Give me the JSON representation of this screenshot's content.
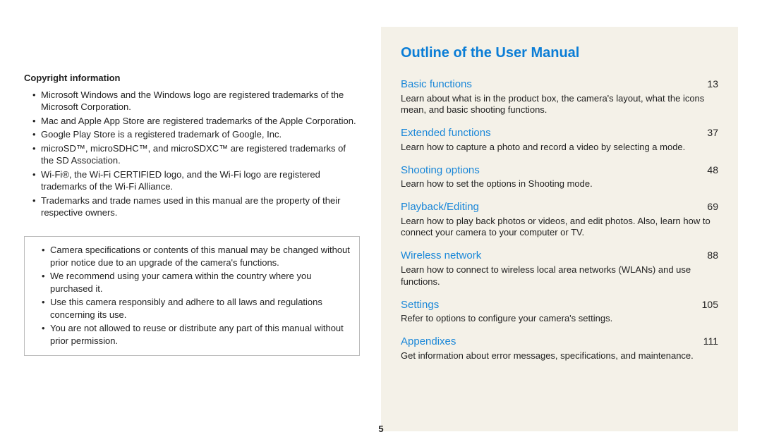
{
  "left": {
    "heading": "Copyright information",
    "bullets": [
      "Microsoft Windows and the Windows logo are registered trademarks of the Microsoft Corporation.",
      "Mac and Apple App Store are registered trademarks of the Apple Corporation.",
      "Google Play Store is a registered trademark of Google, Inc.",
      "microSD™, microSDHC™, and microSDXC™ are registered trademarks of the SD Association.",
      "Wi-Fi®, the Wi-Fi CERTIFIED logo, and the Wi-Fi logo are registered trademarks of the Wi-Fi Alliance.",
      "Trademarks and trade names used in this manual are the property of their respective owners."
    ],
    "notice": [
      "Camera specifications or contents of this manual may be changed without prior notice due to an upgrade of the camera's functions.",
      "We recommend using your camera within the country where you purchased it.",
      "Use this camera responsibly and adhere to all laws and regulations concerning its use.",
      "You are not allowed to reuse or distribute any part of this manual without prior permission."
    ]
  },
  "right": {
    "title": "Outline of the User Manual",
    "items": [
      {
        "name": "Basic functions",
        "page": "13",
        "desc": "Learn about what is in the product box, the camera's layout, what the icons mean, and basic shooting functions."
      },
      {
        "name": "Extended functions",
        "page": "37",
        "desc": "Learn how to capture a photo and record a video by selecting a mode."
      },
      {
        "name": "Shooting options",
        "page": "48",
        "desc": "Learn how to set the options in Shooting mode."
      },
      {
        "name": "Playback/Editing",
        "page": "69",
        "desc": "Learn how to play back photos or videos, and edit photos. Also, learn how to connect your camera to your computer or TV."
      },
      {
        "name": "Wireless network",
        "page": "88",
        "desc": "Learn how to connect to wireless local area networks (WLANs) and use functions."
      },
      {
        "name": "Settings",
        "page": "105",
        "desc": "Refer to options to configure your camera's settings."
      },
      {
        "name": "Appendixes",
        "page": "111",
        "desc": "Get information about error messages, specifications, and maintenance."
      }
    ]
  },
  "pagenum": "5"
}
